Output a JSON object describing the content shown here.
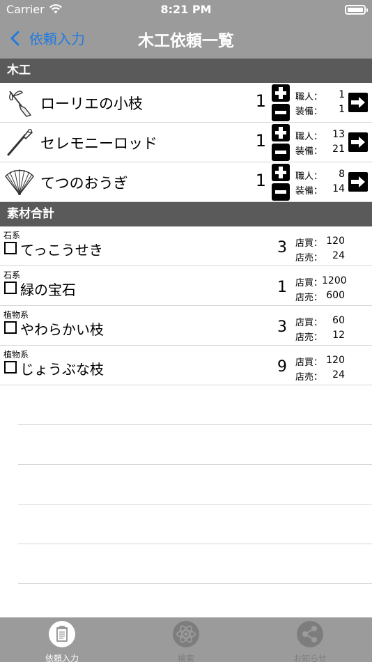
{
  "status_bar": {
    "carrier": "Carrier",
    "time": "8:21 PM"
  },
  "nav": {
    "back_label": "依頼入力",
    "title": "木工依頼一覧"
  },
  "section_woodwork": {
    "title": "木工"
  },
  "requests": [
    {
      "name": "ローリエの小枝",
      "qty": "1",
      "craftsman_label": "職人：",
      "craftsman_value": "1",
      "equip_label": "装備：",
      "equip_value": "1",
      "icon": "twig-icon"
    },
    {
      "name": "セレモニーロッド",
      "qty": "1",
      "craftsman_label": "職人：",
      "craftsman_value": "13",
      "equip_label": "装備：",
      "equip_value": "21",
      "icon": "rod-icon"
    },
    {
      "name": "てつのおうぎ",
      "qty": "1",
      "craftsman_label": "職人：",
      "craftsman_value": "8",
      "equip_label": "装備：",
      "equip_value": "14",
      "icon": "fan-icon"
    }
  ],
  "section_materials": {
    "title": "素材合計"
  },
  "materials": [
    {
      "category": "石系",
      "name": "てっこうせき",
      "qty": "3",
      "buy_label": "店買：",
      "buy_value": "120",
      "sell_label": "店売：",
      "sell_value": "24"
    },
    {
      "category": "石系",
      "name": "緑の宝石",
      "qty": "1",
      "buy_label": "店買：",
      "buy_value": "1200",
      "sell_label": "店売：",
      "sell_value": "600"
    },
    {
      "category": "植物系",
      "name": "やわらかい枝",
      "qty": "3",
      "buy_label": "店買：",
      "buy_value": "60",
      "sell_label": "店売：",
      "sell_value": "12"
    },
    {
      "category": "植物系",
      "name": "じょうぶな枝",
      "qty": "9",
      "buy_label": "店買：",
      "buy_value": "120",
      "sell_label": "店売：",
      "sell_value": "24"
    }
  ],
  "tabbar": {
    "tabs": [
      {
        "label": "依頼入力",
        "icon": "clipboard-icon",
        "active": true
      },
      {
        "label": "検索",
        "icon": "atom-icon",
        "active": false
      },
      {
        "label": "お知らせ",
        "icon": "share-icon",
        "active": false
      }
    ]
  },
  "colors": {
    "nav_bg": "#9b9b9b",
    "section_bg": "#5a5a5a",
    "accent": "#1f7ae0",
    "tab_active": "#ffffff",
    "tab_inactive": "#7d7d7d"
  }
}
